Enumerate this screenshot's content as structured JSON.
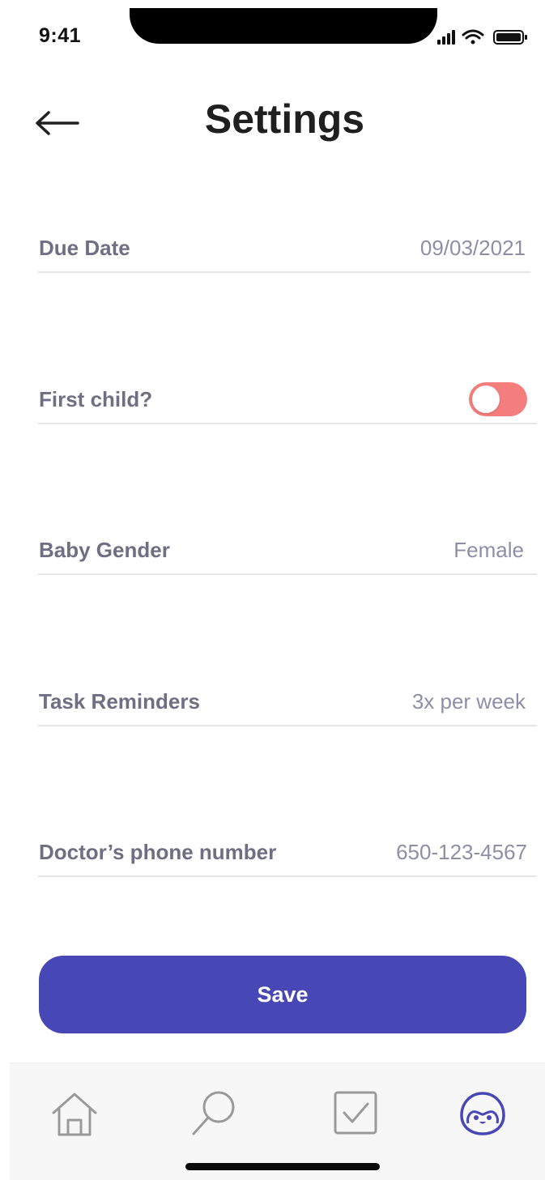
{
  "status_bar": {
    "time": "9:41",
    "icons": [
      "signal-icon",
      "wifi-icon",
      "battery-icon"
    ]
  },
  "header": {
    "back_icon": "arrow-left-icon",
    "title": "Settings"
  },
  "settings": [
    {
      "label": "Due Date",
      "value": "09/03/2021"
    },
    {
      "label": "First child?",
      "type": "toggle",
      "state": "off",
      "toggle_color": "#f47d7d"
    },
    {
      "label": "Baby Gender",
      "value": "Female"
    },
    {
      "label": "Task Reminders",
      "value": "3x per week"
    },
    {
      "label": "Doctor’s phone number",
      "value": "650-123-4567"
    }
  ],
  "save_button": {
    "label": "Save",
    "color": "#4747b5"
  },
  "tabbar": {
    "items": [
      {
        "icon": "home-icon",
        "active": false
      },
      {
        "icon": "search-icon",
        "active": false
      },
      {
        "icon": "checkbox-icon",
        "active": false
      },
      {
        "icon": "penguin-icon",
        "active": true
      }
    ],
    "active_color": "#4747b5",
    "inactive_color": "#9a9a9a"
  }
}
